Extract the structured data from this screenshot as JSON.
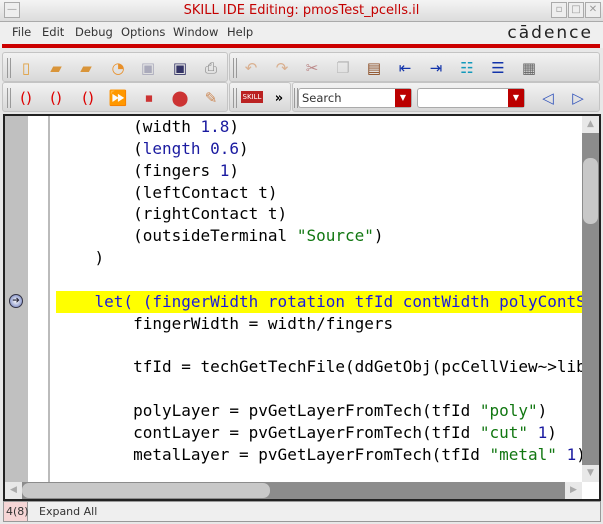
{
  "window": {
    "title": "SKILL IDE Editing: pmosTest_pcells.il"
  },
  "menu": [
    "File",
    "Edit",
    "Debug",
    "Options",
    "Window",
    "Help"
  ],
  "brand": "cādence",
  "toolbar1": [
    "new-file-icon",
    "open-folder-icon",
    "open-new-folder-icon",
    "reload-icon",
    "save-icon",
    "save-as-icon",
    "print-icon",
    "undo-icon",
    "redo-icon",
    "cut-icon",
    "copy-icon",
    "paste-icon",
    "indent-left-icon",
    "indent-right-icon",
    "tree-list-icon",
    "outline-icon",
    "properties-icon"
  ],
  "toolbar2": {
    "search_placeholder": "Search",
    "search_value": "",
    "more": "»",
    "skill_label": "SKILL"
  },
  "code": [
    [
      [
        "",
        "        ("
      ],
      [
        "",
        "width "
      ],
      [
        "num",
        "1.8"
      ],
      [
        "",
        ")"
      ]
    ],
    [
      [
        "",
        "        ("
      ],
      [
        "sym",
        "length"
      ],
      [
        "",
        " "
      ],
      [
        "num",
        "0.6"
      ],
      [
        "",
        ")"
      ]
    ],
    [
      [
        "",
        "        (fingers "
      ],
      [
        "num",
        "1"
      ],
      [
        "",
        ")"
      ]
    ],
    [
      [
        "",
        "        (leftContact t)"
      ]
    ],
    [
      [
        "",
        "        (rightContact t)"
      ]
    ],
    [
      [
        "",
        "        (outsideTerminal "
      ],
      [
        "str",
        "\"Source\""
      ],
      [
        "",
        ")"
      ]
    ],
    [
      [
        "",
        "    )"
      ]
    ],
    [
      [
        "",
        ""
      ]
    ],
    [
      [
        "kw",
        "    let( (fingerWidth rotation tfId contWidth polyContS"
      ]
    ],
    [
      [
        "",
        "        fingerWidth = width/fingers"
      ]
    ],
    [
      [
        "",
        ""
      ]
    ],
    [
      [
        "",
        "        tfId = techGetTechFile(ddGetObj(pcCellView~>lib"
      ]
    ],
    [
      [
        "",
        ""
      ]
    ],
    [
      [
        "",
        "        polyLayer = pvGetLayerFromTech(tfId "
      ],
      [
        "str",
        "\"poly\""
      ],
      [
        "",
        ")"
      ]
    ],
    [
      [
        "",
        "        contLayer = pvGetLayerFromTech(tfId "
      ],
      [
        "str",
        "\"cut\""
      ],
      [
        "",
        " "
      ],
      [
        "num",
        "1"
      ],
      [
        "",
        ")"
      ]
    ],
    [
      [
        "",
        "        metalLayer = pvGetLayerFromTech(tfId "
      ],
      [
        "str",
        "\"metal\""
      ],
      [
        "",
        " "
      ],
      [
        "num",
        "1"
      ],
      [
        "",
        ")"
      ]
    ]
  ],
  "current_line_index": 8,
  "status": {
    "position": "4(8)",
    "message": "Expand All"
  }
}
